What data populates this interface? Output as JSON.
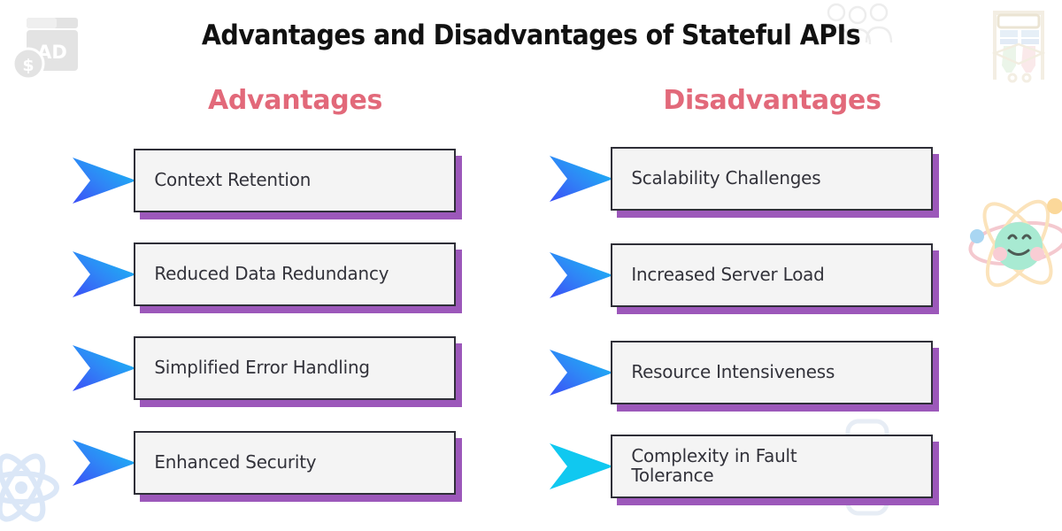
{
  "page": {
    "title": "Advantages and Disadvantages of Stateful APIs",
    "background_color": "#ffffff",
    "heading_color": "#e2697a",
    "box_fill_color": "#f4f4f4",
    "box_border_color": "#2f2f38",
    "box_shadow_color": "#9c58ba",
    "arrow_gradient_from": "#13c3f3",
    "arrow_gradient_to": "#3b5bf5",
    "arrow_solid_color": "#10c8f0",
    "text_color": "#32323a"
  },
  "columns": [
    {
      "heading": "Advantages",
      "items": [
        {
          "label": "Context Retention",
          "arrow_style": "gradient"
        },
        {
          "label": "Reduced Data Redundancy",
          "arrow_style": "gradient"
        },
        {
          "label": "Simplified Error Handling",
          "arrow_style": "gradient"
        },
        {
          "label": "Enhanced Security",
          "arrow_style": "gradient"
        }
      ]
    },
    {
      "heading": "Disadvantages",
      "items": [
        {
          "label": "Scalability Challenges",
          "arrow_style": "gradient"
        },
        {
          "label": "Increased Server Load",
          "arrow_style": "gradient"
        },
        {
          "label": "Resource Intensiveness",
          "arrow_style": "gradient"
        },
        {
          "label": "Complexity in Fault\nTolerance",
          "arrow_style": "solid"
        }
      ]
    }
  ],
  "decorations": [
    {
      "name": "ad-banner-icon",
      "description": "browser window with AD and dollar coin"
    },
    {
      "name": "people-group-icon",
      "description": "three people silhouettes"
    },
    {
      "name": "clothes-rack-icon",
      "description": "pastel clothing rack"
    },
    {
      "name": "atom-smiley-icon",
      "description": "atom orbits around smiling face"
    },
    {
      "name": "react-atom-icon",
      "description": "light blue react style atom"
    },
    {
      "name": "phone-outline-icon",
      "description": "faint rounded phone outline"
    }
  ]
}
